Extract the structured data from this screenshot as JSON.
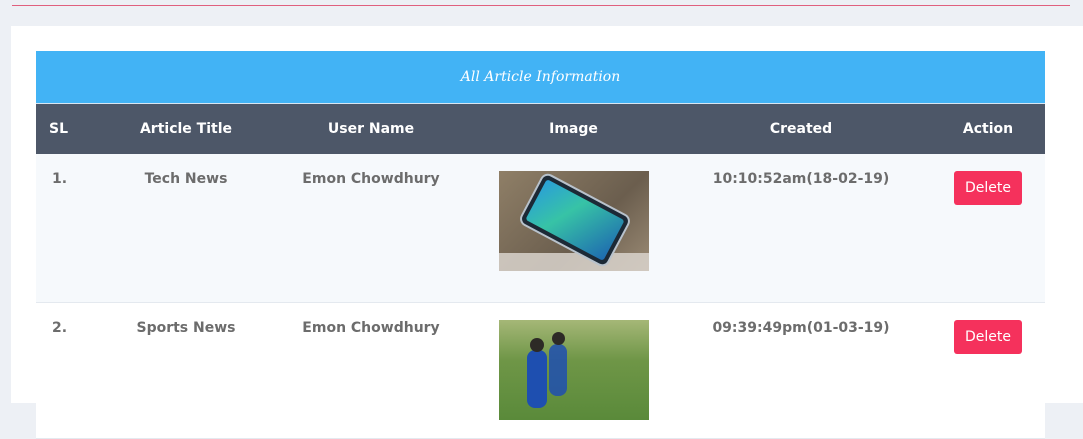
{
  "panel": {
    "title": "All Article Information"
  },
  "table": {
    "headers": {
      "sl": "SL",
      "title": "Article Title",
      "user": "User Name",
      "image": "Image",
      "created": "Created",
      "action": "Action"
    },
    "rows": [
      {
        "sl": "1.",
        "title": "Tech News",
        "user": "Emon Chowdhury",
        "image": "phone-photo",
        "created": "10:10:52am(18-02-19)",
        "action": "Delete"
      },
      {
        "sl": "2.",
        "title": "Sports News",
        "user": "Emon Chowdhury",
        "image": "cricketers-photo",
        "created": "09:39:49pm(01-03-19)",
        "action": "Delete"
      }
    ]
  },
  "colors": {
    "header_bar": "#42b3f5",
    "table_head": "#4d5768",
    "delete_button": "#f5315c"
  }
}
